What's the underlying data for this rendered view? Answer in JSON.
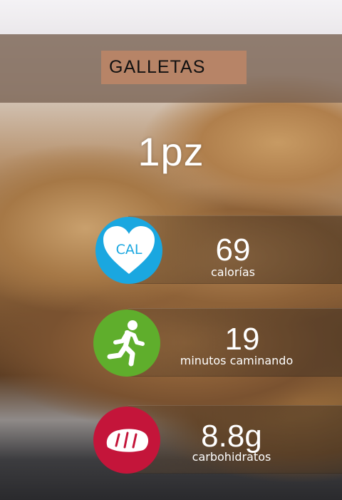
{
  "title": "GALLETAS",
  "portion": "1pz",
  "stats": [
    {
      "value": "69",
      "label": "calorías",
      "icon": "heart-cal-icon",
      "icon_text": "CAL",
      "color": "#1aa7e0"
    },
    {
      "value": "19",
      "label": "minutos caminando",
      "icon": "runner-icon",
      "color": "#5fae2c"
    },
    {
      "value": "8.8g",
      "label": "carbohidratos",
      "icon": "bread-icon",
      "color": "#c4153a"
    }
  ],
  "colors": {
    "title_box": "#b78467",
    "title_bar": "#786252"
  }
}
